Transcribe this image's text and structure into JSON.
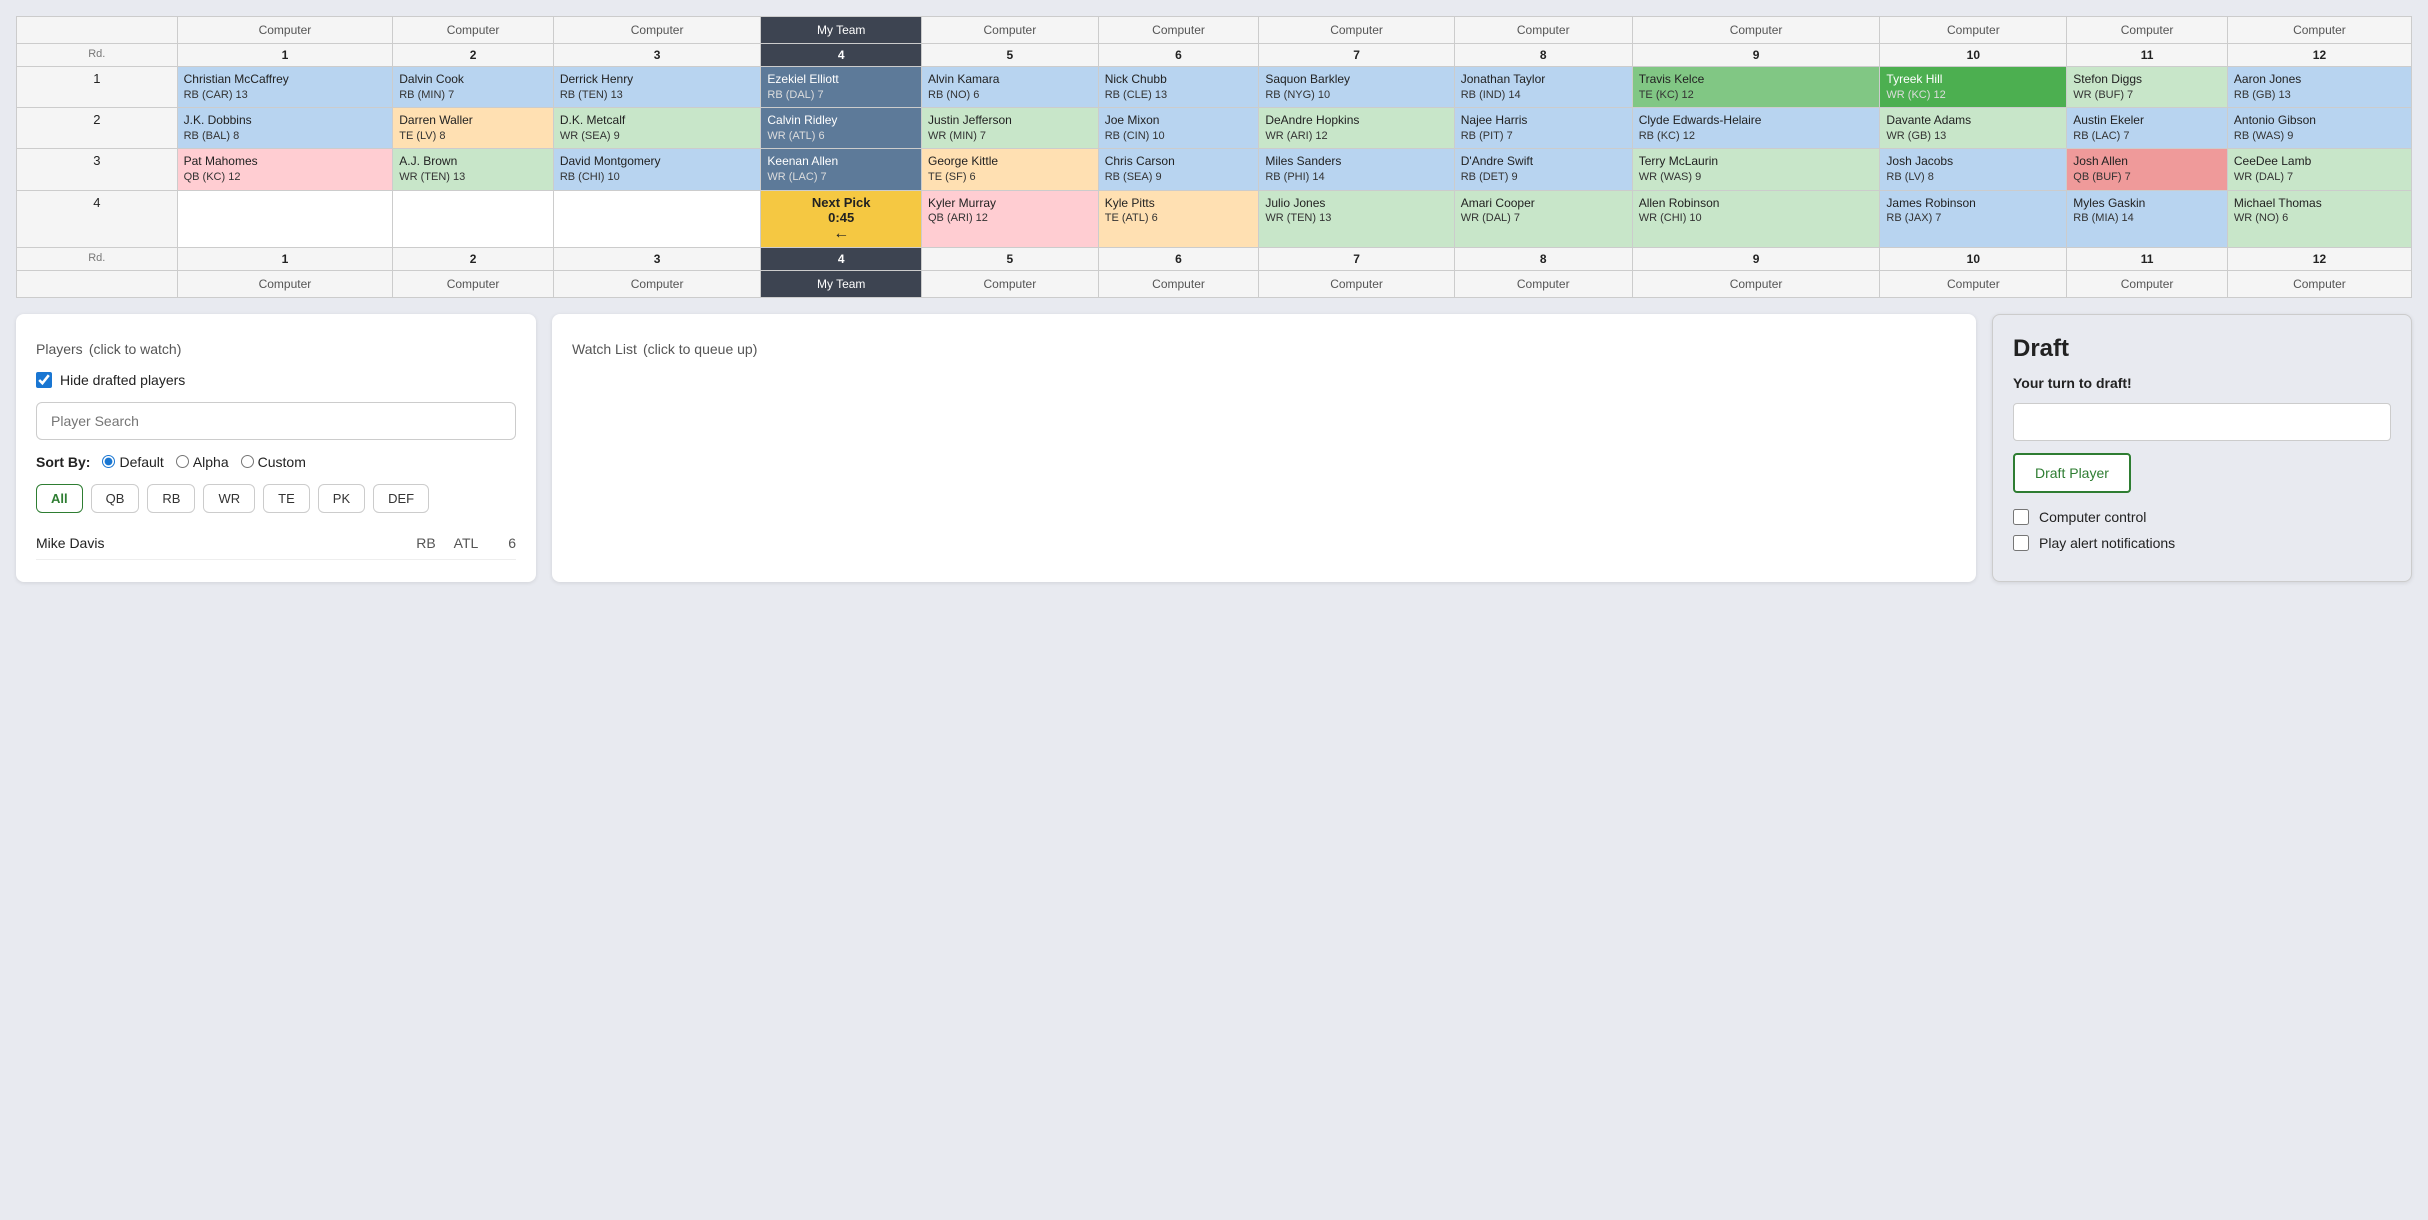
{
  "table": {
    "headers": [
      "Computer",
      "Computer",
      "Computer",
      "My Team",
      "Computer",
      "Computer",
      "Computer",
      "Computer",
      "Computer",
      "Computer",
      "Computer",
      "Computer"
    ],
    "picks": [
      1,
      2,
      3,
      4,
      5,
      6,
      7,
      8,
      9,
      10,
      11,
      12
    ],
    "rows": [
      {
        "round": 1,
        "cells": [
          {
            "name": "Christian McCaffrey",
            "pos": "RB",
            "team": "CAR",
            "rank": 13,
            "color": "rb"
          },
          {
            "name": "Dalvin Cook",
            "pos": "RB",
            "team": "MIN",
            "rank": 7,
            "color": "rb"
          },
          {
            "name": "Derrick Henry",
            "pos": "RB",
            "team": "TEN",
            "rank": 13,
            "color": "rb"
          },
          {
            "name": "Ezekiel Elliott",
            "pos": "RB",
            "team": "DAL",
            "rank": 7,
            "color": "rb",
            "myTeam": true
          },
          {
            "name": "Alvin Kamara",
            "pos": "RB",
            "team": "NO",
            "rank": 6,
            "color": "rb"
          },
          {
            "name": "Nick Chubb",
            "pos": "RB",
            "team": "CLE",
            "rank": 13,
            "color": "rb"
          },
          {
            "name": "Saquon Barkley",
            "pos": "RB",
            "team": "NYG",
            "rank": 10,
            "color": "rb"
          },
          {
            "name": "Jonathan Taylor",
            "pos": "RB",
            "team": "IND",
            "rank": 14,
            "color": "rb"
          },
          {
            "name": "Travis Kelce",
            "pos": "TE",
            "team": "KC",
            "rank": 12,
            "color": "te-green"
          },
          {
            "name": "Tyreek Hill",
            "pos": "WR",
            "team": "KC",
            "rank": 12,
            "color": "wr-green"
          },
          {
            "name": "Stefon Diggs",
            "pos": "WR",
            "team": "BUF",
            "rank": 7,
            "color": "wr"
          },
          {
            "name": "Aaron Jones",
            "pos": "RB",
            "team": "GB",
            "rank": 13,
            "color": "rb"
          }
        ]
      },
      {
        "round": 2,
        "cells": [
          {
            "name": "J.K. Dobbins",
            "pos": "RB",
            "team": "BAL",
            "rank": 8,
            "color": "rb"
          },
          {
            "name": "Darren Waller",
            "pos": "TE",
            "team": "LV",
            "rank": 8,
            "color": "te"
          },
          {
            "name": "D.K. Metcalf",
            "pos": "WR",
            "team": "SEA",
            "rank": 9,
            "color": "wr"
          },
          {
            "name": "Calvin Ridley",
            "pos": "WR",
            "team": "ATL",
            "rank": 6,
            "color": "wr",
            "myTeam": true
          },
          {
            "name": "Justin Jefferson",
            "pos": "WR",
            "team": "MIN",
            "rank": 7,
            "color": "wr"
          },
          {
            "name": "Joe Mixon",
            "pos": "RB",
            "team": "CIN",
            "rank": 10,
            "color": "rb"
          },
          {
            "name": "DeAndre Hopkins",
            "pos": "WR",
            "team": "ARI",
            "rank": 12,
            "color": "wr"
          },
          {
            "name": "Najee Harris",
            "pos": "RB",
            "team": "PIT",
            "rank": 7,
            "color": "rb"
          },
          {
            "name": "Clyde Edwards-Helaire",
            "pos": "RB",
            "team": "KC",
            "rank": 12,
            "color": "rb"
          },
          {
            "name": "Davante Adams",
            "pos": "WR",
            "team": "GB",
            "rank": 13,
            "color": "wr"
          },
          {
            "name": "Austin Ekeler",
            "pos": "RB",
            "team": "LAC",
            "rank": 7,
            "color": "rb"
          },
          {
            "name": "Antonio Gibson",
            "pos": "RB",
            "team": "WAS",
            "rank": 9,
            "color": "rb"
          }
        ]
      },
      {
        "round": 3,
        "cells": [
          {
            "name": "Pat Mahomes",
            "pos": "QB",
            "team": "KC",
            "rank": 12,
            "color": "qb"
          },
          {
            "name": "A.J. Brown",
            "pos": "WR",
            "team": "TEN",
            "rank": 13,
            "color": "wr"
          },
          {
            "name": "David Montgomery",
            "pos": "RB",
            "team": "CHI",
            "rank": 10,
            "color": "rb"
          },
          {
            "name": "Keenan Allen",
            "pos": "WR",
            "team": "LAC",
            "rank": 7,
            "color": "wr",
            "myTeam": true
          },
          {
            "name": "George Kittle",
            "pos": "TE",
            "team": "SF",
            "rank": 6,
            "color": "te"
          },
          {
            "name": "Chris Carson",
            "pos": "RB",
            "team": "SEA",
            "rank": 9,
            "color": "rb"
          },
          {
            "name": "Miles Sanders",
            "pos": "RB",
            "team": "PHI",
            "rank": 14,
            "color": "rb"
          },
          {
            "name": "D'Andre Swift",
            "pos": "RB",
            "team": "DET",
            "rank": 9,
            "color": "rb"
          },
          {
            "name": "Terry McLaurin",
            "pos": "WR",
            "team": "WAS",
            "rank": 9,
            "color": "wr"
          },
          {
            "name": "Josh Jacobs",
            "pos": "RB",
            "team": "LV",
            "rank": 8,
            "color": "rb"
          },
          {
            "name": "Josh Allen",
            "pos": "QB",
            "team": "BUF",
            "rank": 7,
            "color": "qb-green"
          },
          {
            "name": "CeeDee Lamb",
            "pos": "WR",
            "team": "DAL",
            "rank": 7,
            "color": "wr"
          }
        ]
      },
      {
        "round": 4,
        "cells": [
          {
            "name": "",
            "pos": "",
            "team": "",
            "rank": null,
            "color": "empty"
          },
          {
            "name": "",
            "pos": "",
            "team": "",
            "rank": null,
            "color": "empty"
          },
          {
            "name": "",
            "pos": "",
            "team": "",
            "rank": null,
            "color": "empty"
          },
          {
            "name": "Next Pick 0:45",
            "pos": "",
            "team": "",
            "rank": null,
            "color": "nextpick",
            "myTeam": true
          },
          {
            "name": "Kyler Murray",
            "pos": "QB",
            "team": "ARI",
            "rank": 12,
            "color": "qb"
          },
          {
            "name": "Kyle Pitts",
            "pos": "TE",
            "team": "ATL",
            "rank": 6,
            "color": "te"
          },
          {
            "name": "Julio Jones",
            "pos": "WR",
            "team": "TEN",
            "rank": 13,
            "color": "wr"
          },
          {
            "name": "Amari Cooper",
            "pos": "WR",
            "team": "DAL",
            "rank": 7,
            "color": "wr"
          },
          {
            "name": "Allen Robinson",
            "pos": "WR",
            "team": "CHI",
            "rank": 10,
            "color": "wr"
          },
          {
            "name": "James Robinson",
            "pos": "RB",
            "team": "JAX",
            "rank": 7,
            "color": "rb"
          },
          {
            "name": "Myles Gaskin",
            "pos": "RB",
            "team": "MIA",
            "rank": 14,
            "color": "rb"
          },
          {
            "name": "Michael Thomas",
            "pos": "WR",
            "team": "NO",
            "rank": 6,
            "color": "wr"
          }
        ]
      }
    ]
  },
  "players_panel": {
    "title": "Players",
    "subtitle": "(click to watch)",
    "hide_drafted_label": "Hide drafted players",
    "search_placeholder": "Player Search",
    "sort_by_label": "Sort By:",
    "sort_options": [
      "Default",
      "Alpha",
      "Custom"
    ],
    "positions": [
      "All",
      "QB",
      "RB",
      "WR",
      "TE",
      "PK",
      "DEF"
    ],
    "active_position": "All",
    "player": {
      "name": "Mike Davis",
      "pos": "RB",
      "team": "ATL",
      "rank": 6
    }
  },
  "watchlist_panel": {
    "title": "Watch List",
    "subtitle": "(click to queue up)"
  },
  "draft_panel": {
    "title": "Draft",
    "your_turn_text": "Your turn to draft!",
    "draft_button_label": "Draft Player",
    "computer_control_label": "Computer control",
    "play_alerts_label": "Play alert notifications"
  }
}
